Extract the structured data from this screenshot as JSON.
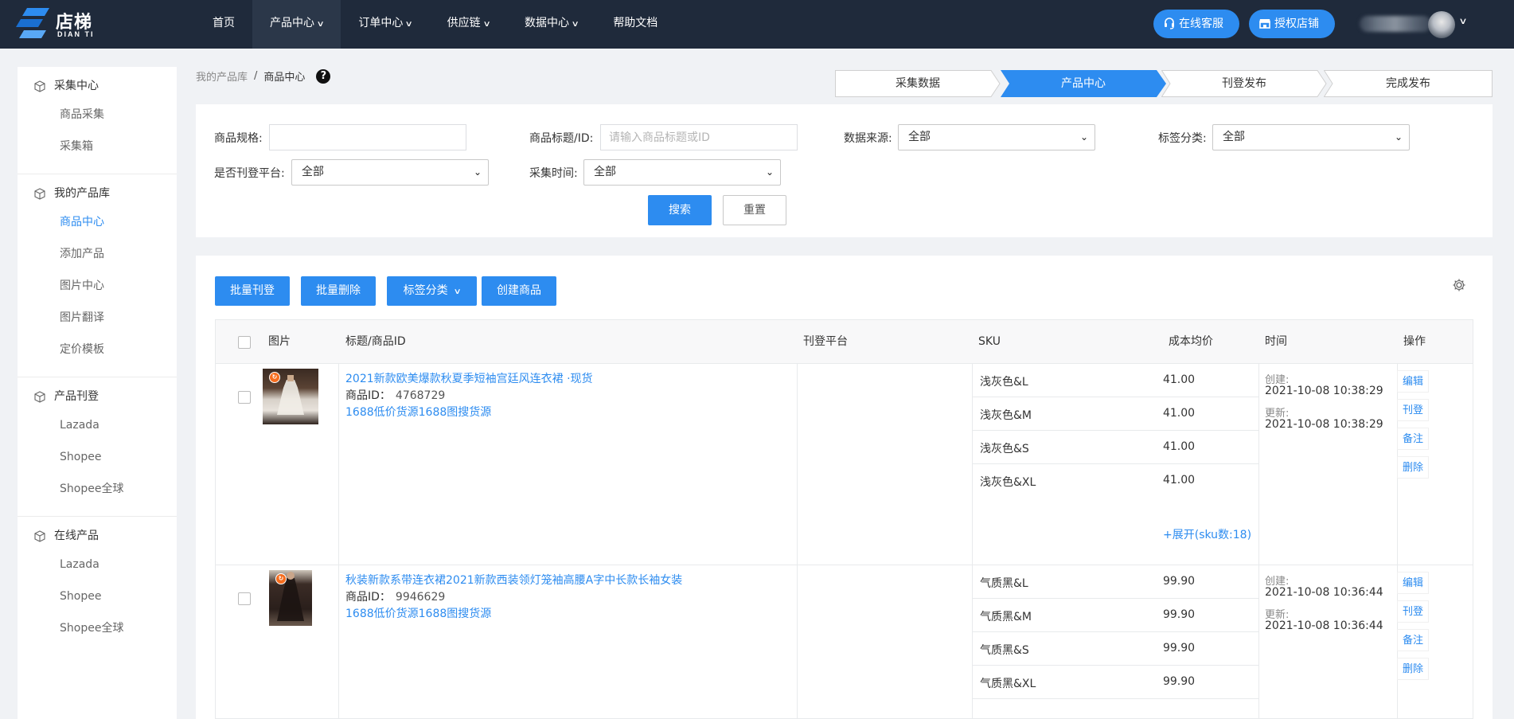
{
  "brand": {
    "name": "店梯",
    "sub": "DIAN TI"
  },
  "nav": [
    {
      "label": "首页",
      "dropdown": false
    },
    {
      "label": "产品中心",
      "dropdown": true
    },
    {
      "label": "订单中心",
      "dropdown": true
    },
    {
      "label": "供应链",
      "dropdown": true
    },
    {
      "label": "数据中心",
      "dropdown": true
    },
    {
      "label": "帮助文档",
      "dropdown": false
    }
  ],
  "header_actions": {
    "service": "在线客服",
    "auth_shop": "授权店铺"
  },
  "sidebar": {
    "groups": [
      {
        "title": "采集中心",
        "items": [
          "商品采集",
          "采集箱"
        ]
      },
      {
        "title": "我的产品库",
        "items": [
          "商品中心",
          "添加产品",
          "图片中心",
          "图片翻译",
          "定价模板"
        ]
      },
      {
        "title": "产品刊登",
        "items": [
          "Lazada",
          "Shopee",
          "Shopee全球"
        ]
      },
      {
        "title": "在线产品",
        "items": [
          "Lazada",
          "Shopee",
          "Shopee全球"
        ]
      }
    ],
    "active_item": "商品中心"
  },
  "breadcrumb": {
    "parent": "我的产品库",
    "separator": "/",
    "current": "商品中心",
    "help": "?"
  },
  "steps": [
    "采集数据",
    "产品中心",
    "刊登发布",
    "完成发布"
  ],
  "filters": {
    "spec_label": "商品规格:",
    "spec_value": "",
    "title_label": "商品标题/ID:",
    "title_placeholder": "请输入商品标题或ID",
    "source_label": "数据来源:",
    "source_value": "全部",
    "tag_label": "标签分类:",
    "tag_value": "全部",
    "listed_label": "是否刊登平台:",
    "listed_value": "全部",
    "time_label": "采集时间:",
    "time_value": "全部",
    "search_btn": "搜索",
    "reset_btn": "重置"
  },
  "toolbar": {
    "batch_list": "批量刊登",
    "batch_delete": "批量删除",
    "tag_category": "标签分类",
    "create": "创建商品"
  },
  "table": {
    "headers": {
      "image": "图片",
      "title": "标题/商品ID",
      "platform": "刊登平台",
      "sku": "SKU",
      "cost": "成本均价",
      "time": "时间",
      "ops": "操作"
    },
    "id_label": "商品ID：",
    "source_label": "1688低价货源1688图搜货源",
    "created_label": "创建:",
    "updated_label": "更新:",
    "ops": [
      "编辑",
      "刊登",
      "备注",
      "删除"
    ],
    "rows": [
      {
        "title": "2021新款欧美爆款秋夏季短袖宫廷风连衣裙 ·现货",
        "id": "4768729",
        "skus": [
          {
            "name": "浅灰色&L",
            "price": "41.00"
          },
          {
            "name": "浅灰色&M",
            "price": "41.00"
          },
          {
            "name": "浅灰色&S",
            "price": "41.00"
          },
          {
            "name": "浅灰色&XL",
            "price": "41.00"
          }
        ],
        "expand": "+展开(sku数:18)",
        "created": "2021-10-08 10:38:29",
        "updated": "2021-10-08 10:38:29"
      },
      {
        "title": "秋装新款系带连衣裙2021新款西装领灯笼袖高腰A字中长款长袖女装",
        "id": "9946629",
        "skus": [
          {
            "name": "气质黑&L",
            "price": "99.90"
          },
          {
            "name": "气质黑&M",
            "price": "99.90"
          },
          {
            "name": "气质黑&S",
            "price": "99.90"
          },
          {
            "name": "气质黑&XL",
            "price": "99.90"
          }
        ],
        "created": "2021-10-08 10:36:44",
        "updated": "2021-10-08 10:36:44"
      }
    ]
  },
  "icons": {
    "headset": "headset-icon",
    "store": "store-icon",
    "box": "box-icon",
    "gear": "gear-icon",
    "help": "help-icon"
  },
  "colors": {
    "primary": "#2d8cf0",
    "topbar": "#1f2a3b",
    "link": "#2d8cf0"
  }
}
